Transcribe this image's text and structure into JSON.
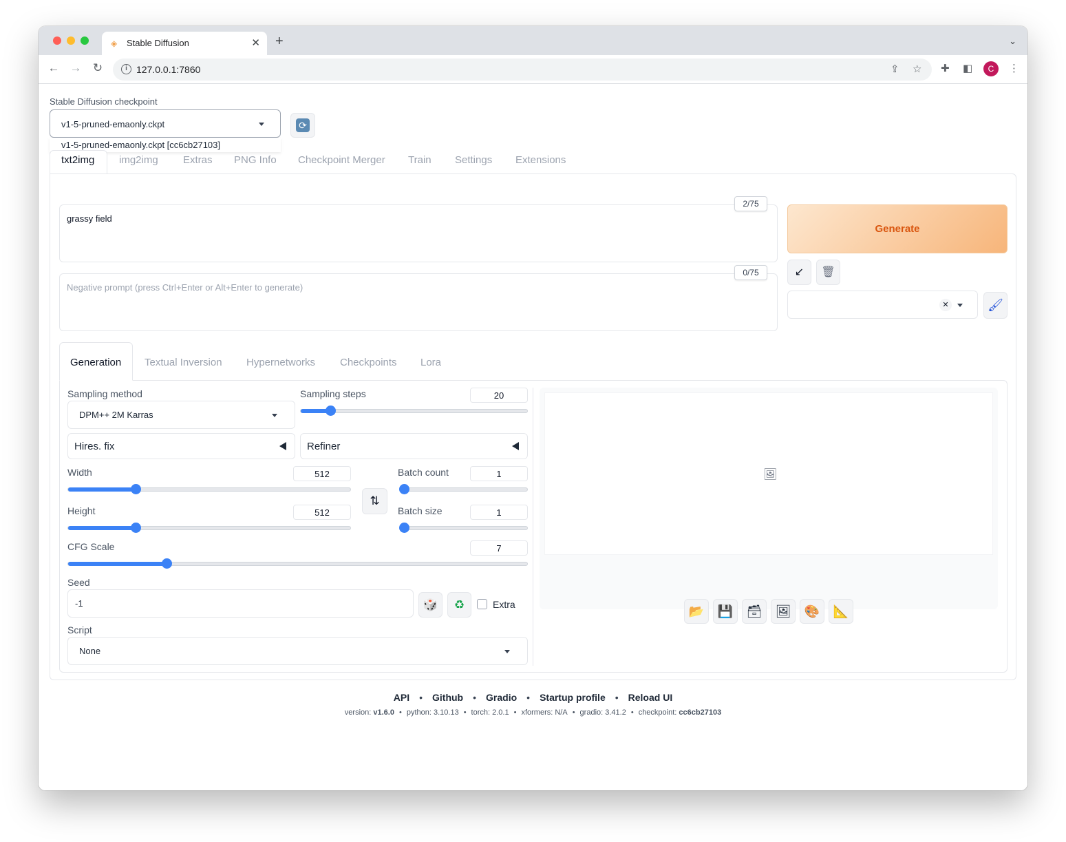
{
  "browser": {
    "tab_title": "Stable Diffusion",
    "url": "127.0.0.1:7860",
    "avatar_letter": "C"
  },
  "checkpoint": {
    "label": "Stable Diffusion checkpoint",
    "value": "v1-5-pruned-emaonly.ckpt",
    "option": "v1-5-pruned-emaonly.ckpt [cc6cb27103]"
  },
  "main_tabs": [
    "txt2img",
    "img2img",
    "Extras",
    "PNG Info",
    "Checkpoint Merger",
    "Train",
    "Settings",
    "Extensions"
  ],
  "prompt": {
    "text": "grassy field",
    "counter": "2/75",
    "negative_placeholder": "Negative prompt (press Ctrl+Enter or Alt+Enter to generate)",
    "negative_counter": "0/75"
  },
  "generate_label": "Generate",
  "sub_tabs": [
    "Generation",
    "Textual Inversion",
    "Hypernetworks",
    "Checkpoints",
    "Lora"
  ],
  "generation": {
    "sampling_method_label": "Sampling method",
    "sampling_method": "DPM++ 2M Karras",
    "sampling_steps_label": "Sampling steps",
    "sampling_steps": "20",
    "sampling_steps_fraction": 0.13,
    "hires_label": "Hires. fix",
    "refiner_label": "Refiner",
    "width_label": "Width",
    "width": "512",
    "width_fraction": 0.24,
    "height_label": "Height",
    "height": "512",
    "height_fraction": 0.24,
    "batch_count_label": "Batch count",
    "batch_count": "1",
    "batch_count_fraction": 0.0,
    "batch_size_label": "Batch size",
    "batch_size": "1",
    "batch_size_fraction": 0.0,
    "cfg_label": "CFG Scale",
    "cfg": "7",
    "cfg_fraction": 0.215,
    "seed_label": "Seed",
    "seed": "-1",
    "extra_label": "Extra",
    "script_label": "Script",
    "script": "None"
  },
  "footer": {
    "links": [
      "API",
      "Github",
      "Gradio",
      "Startup profile",
      "Reload UI"
    ],
    "version_label": "version:",
    "version": "v1.6.0",
    "python": "python: 3.10.13",
    "torch": "torch: 2.0.1",
    "xformers": "xformers: N/A",
    "gradio": "gradio: 3.41.2",
    "checkpoint_label": "checkpoint:",
    "checkpoint": "cc6cb27103"
  },
  "colors": {
    "accent": "#3b82f6",
    "generate_text": "#d9560f"
  }
}
